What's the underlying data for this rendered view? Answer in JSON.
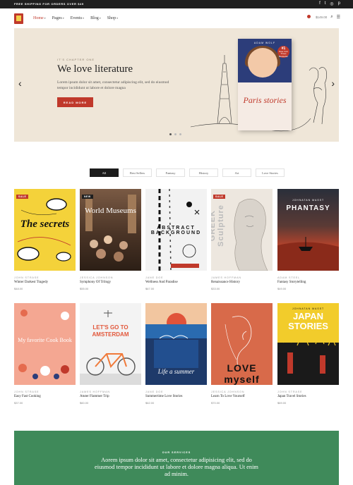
{
  "topbar": {
    "shipping_text": "FREE SHIPPING FOR ORDERS OVER $49",
    "social_icons": [
      "facebook-icon",
      "twitter-icon",
      "instagram-icon",
      "pinterest-icon"
    ]
  },
  "header": {
    "nav": [
      {
        "label": "Home",
        "active": true
      },
      {
        "label": "Pages",
        "active": false
      },
      {
        "label": "Events",
        "active": false
      },
      {
        "label": "Blog",
        "active": false
      },
      {
        "label": "Shop",
        "active": false
      }
    ],
    "cart_total": "$149.00",
    "icons": [
      "cart-icon",
      "search-icon",
      "menu-icon"
    ]
  },
  "hero": {
    "eyebrow": "IT'S CHAPTER ONE",
    "title": "We love literature",
    "description": "Lorem ipsum dolor sit amet, consectetur adipiscing elit, sed do eiusmod tempor incididunt ut labore et dolore magna",
    "button_label": "READ MORE",
    "book": {
      "author": "ADAM WOLF",
      "badge_rank": "#1",
      "badge_text": "New York Times Bestseller",
      "title": "Paris stories"
    },
    "slides": 3,
    "active_slide": 1,
    "background": "#efe6d8"
  },
  "filters": [
    "All",
    "Best Sellers",
    "Fantasy",
    "History",
    "Art",
    "Love Stories"
  ],
  "active_filter": "All",
  "books": [
    {
      "author": "JOHN STRASE",
      "title": "Winter Darkest Tragedy",
      "price": "$48.00",
      "tag": "SALE",
      "cover_text": "The secrets"
    },
    {
      "author": "JESSICA JOHNSON",
      "title": "Symphony Of Trilogy",
      "price": "$55.00",
      "tag": "NEW",
      "cover_text": "World Museums"
    },
    {
      "author": "JANE DOE",
      "title": "Wellness And Paradise",
      "price": "$67.00",
      "tag": "",
      "cover_text": "ABSTRACT BACKGROUND"
    },
    {
      "author": "JAMES HOFFMAN",
      "title": "Renaissance History",
      "price": "$33.00",
      "tag": "SALE",
      "cover_text": "GREEK Sculpture"
    },
    {
      "author": "ADAM STEEL",
      "title": "Fantasy Storytelling",
      "price": "$49.00",
      "tag": "",
      "cover_text": "PHANTASY",
      "cover_author": "JOHNATAN MASST"
    },
    {
      "author": "JOHN STRASE",
      "title": "Easy Fast Cooking",
      "price": "$37.00",
      "tag": "",
      "cover_text": "My favorite Cook Book"
    },
    {
      "author": "JAMES HOFFMAN",
      "title": "Atuter Flammer Trip",
      "price": "$60.00",
      "tag": "",
      "cover_text": "LET'S GO TO AMSTERDAM"
    },
    {
      "author": "JANE DOE",
      "title": "Summertime Love Stories",
      "price": "$62.00",
      "tag": "",
      "cover_text": "Life a summer"
    },
    {
      "author": "JESSICA JOHNSON",
      "title": "Learn To Love Yourself",
      "price": "$70.00",
      "tag": "",
      "cover_text": "LOVE myself"
    },
    {
      "author": "JOHN STRASE",
      "title": "Japan Travel Stories",
      "price": "$69.00",
      "tag": "",
      "cover_text": "JAPAN STORIES",
      "cover_author": "JOHNATAN MASST"
    }
  ],
  "services": {
    "label": "OUR SERVICES",
    "text": "Aorem ipsum dolor sit amet, consectetur adipisicing elit, sed do eiusmod tempor incididunt ut labore et dolore magna aliqua. Ut enim ad minim.",
    "background": "#3f8a5a"
  },
  "colors": {
    "accent": "#c0392b",
    "dark": "#1f1f1f"
  }
}
